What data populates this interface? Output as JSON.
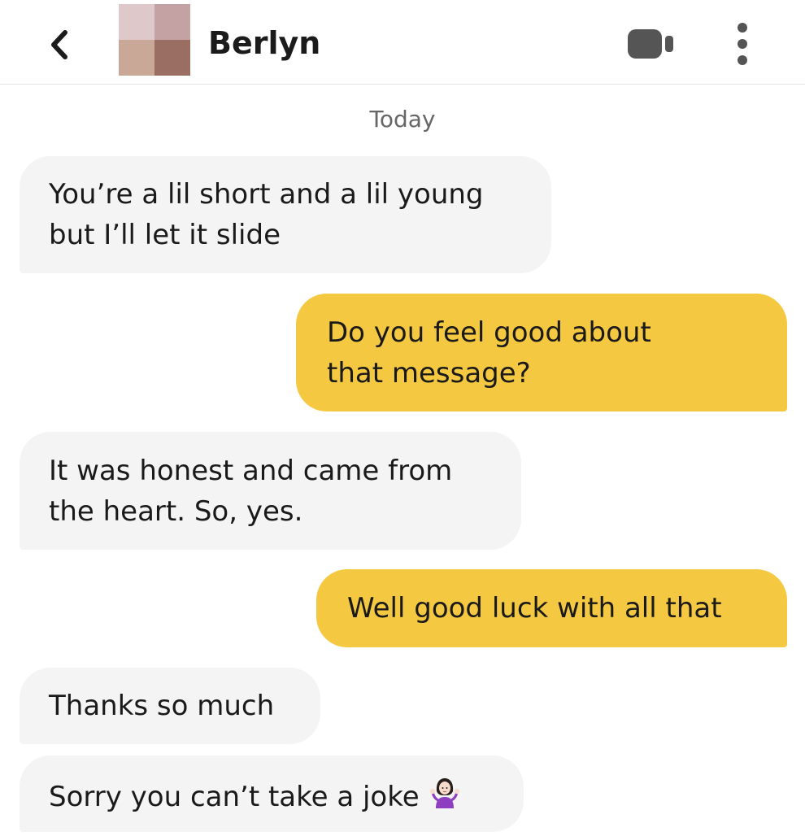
{
  "header": {
    "back_icon": "chevron-left-icon",
    "contact_name": "Berlyn",
    "avatar_colors": [
      "#dfc8c9",
      "#c4a2a4",
      "#c9a898",
      "#9a6e62"
    ],
    "video_icon": "video-camera-icon",
    "more_icon": "more-vertical-icon"
  },
  "chat": {
    "date_label": "Today",
    "messages": [
      {
        "direction": "incoming",
        "lines": [
          "You’re a lil short and a lil young",
          "but I’ll let it slide"
        ]
      },
      {
        "direction": "outgoing",
        "lines": [
          "Do you feel good about",
          "that message?"
        ]
      },
      {
        "direction": "incoming",
        "lines": [
          "It was honest and came from",
          "the heart. So, yes."
        ]
      },
      {
        "direction": "outgoing",
        "lines": [
          "Well good luck with all that"
        ]
      },
      {
        "direction": "incoming",
        "lines": [
          "Thanks so much"
        ]
      },
      {
        "direction": "incoming",
        "lines": [
          "Sorry you can’t take a joke"
        ],
        "emoji": "person-shrugging-emoji"
      }
    ]
  },
  "colors": {
    "incoming_bubble": "#f4f4f4",
    "outgoing_bubble": "#f5c842",
    "text": "#1a1a1a",
    "icon": "#555555"
  }
}
